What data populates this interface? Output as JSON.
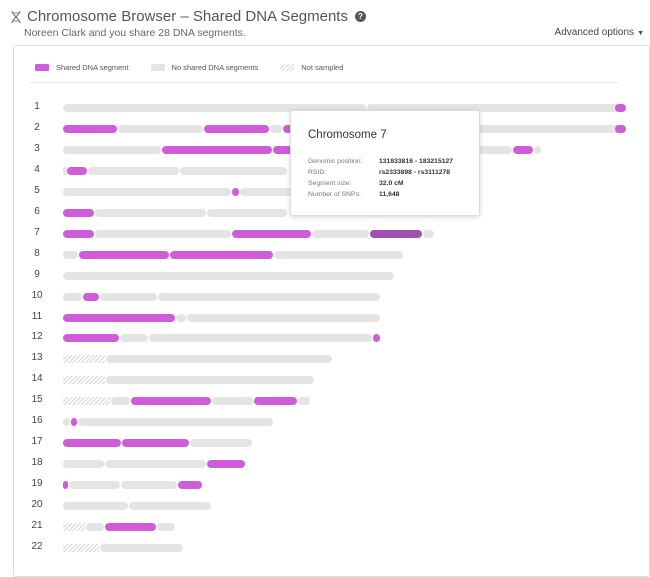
{
  "header": {
    "title": "Chromosome Browser – Shared DNA Segments",
    "subtitle": "Noreen Clark and you share 28 DNA segments.",
    "advanced_label": "Advanced options"
  },
  "legend": {
    "shared": "Shared DNA segment",
    "none": "No shared DNA segments",
    "not_sampled": "Not sampled"
  },
  "colors": {
    "shared": "#cf5cd9",
    "selected": "#a14fb0",
    "none": "#e4e4e4"
  },
  "tooltip": {
    "title": "Chromosome 7",
    "rows": [
      {
        "label": "Genomic position:",
        "value": "131833816 - 183215127"
      },
      {
        "label": "RSID:",
        "value": "rs2333898 - rs3111278"
      },
      {
        "label": "Segment size:",
        "value": "32.0 cM"
      },
      {
        "label": "Number of SNPs:",
        "value": "11,648"
      }
    ]
  },
  "chromosomes": [
    {
      "label": "1",
      "segments": [
        [
          "none",
          0,
          0.54
        ],
        [
          "none",
          0.54,
          1.0
        ],
        [
          "shared",
          1.0,
          1.0
        ]
      ]
    },
    {
      "label": "2",
      "segments": [
        [
          "shared",
          0,
          0.0975
        ],
        [
          "none",
          0.0975,
          0.25
        ],
        [
          "shared",
          0.25,
          0.368
        ],
        [
          "none",
          0.368,
          0.39
        ],
        [
          "shared",
          0.39,
          0.41
        ],
        [
          "none",
          0.41,
          1.0
        ],
        [
          "shared",
          1.0,
          1.0
        ]
      ]
    },
    {
      "label": "3",
      "segments": [
        [
          "none",
          0,
          0.175
        ],
        [
          "shared",
          0.175,
          0.373
        ],
        [
          "shared",
          0.373,
          0.435
        ],
        [
          "none",
          0.435,
          0.8
        ],
        [
          "shared",
          0.8,
          0.837
        ],
        [
          "none",
          0.837,
          0.85
        ]
      ]
    },
    {
      "label": "4",
      "segments": [
        [
          "none",
          0,
          0.007
        ],
        [
          "shared",
          0.007,
          0.045
        ],
        [
          "none",
          0.045,
          0.208
        ],
        [
          "none",
          0.208,
          0.4
        ]
      ]
    },
    {
      "label": "5",
      "segments": [
        [
          "none",
          0,
          0.3
        ],
        [
          "shared",
          0.3,
          0.315
        ],
        [
          "none",
          0.315,
          0.42
        ]
      ]
    },
    {
      "label": "6",
      "segments": [
        [
          "shared",
          0,
          0.057
        ],
        [
          "none",
          0.057,
          0.255
        ],
        [
          "none",
          0.255,
          0.4
        ]
      ]
    },
    {
      "label": "7",
      "segments": [
        [
          "shared",
          0,
          0.057
        ],
        [
          "none",
          0.057,
          0.3
        ],
        [
          "shared",
          0.3,
          0.443
        ],
        [
          "none",
          0.443,
          0.545
        ],
        [
          "sel",
          0.545,
          0.64
        ],
        [
          "none",
          0.64,
          0.66
        ]
      ]
    },
    {
      "label": "8",
      "segments": [
        [
          "none",
          0,
          0.028
        ],
        [
          "shared",
          0.028,
          0.19
        ],
        [
          "shared",
          0.19,
          0.375
        ],
        [
          "none",
          0.375,
          0.605
        ]
      ]
    },
    {
      "label": "9",
      "segments": [
        [
          "none",
          0,
          0.59
        ]
      ]
    },
    {
      "label": "10",
      "segments": [
        [
          "none",
          0,
          0.035
        ],
        [
          "shared",
          0.035,
          0.065
        ],
        [
          "none",
          0.065,
          0.168
        ],
        [
          "none",
          0.168,
          0.565
        ]
      ]
    },
    {
      "label": "11",
      "segments": [
        [
          "shared",
          0,
          0.2
        ],
        [
          "none",
          0.2,
          0.22
        ],
        [
          "none",
          0.22,
          0.565
        ]
      ]
    },
    {
      "label": "12",
      "segments": [
        [
          "shared",
          0,
          0.102
        ],
        [
          "none",
          0.102,
          0.152
        ],
        [
          "none",
          0.152,
          0.55
        ],
        [
          "shared",
          0.55,
          0.565
        ]
      ]
    },
    {
      "label": "13",
      "segments": [
        [
          "ns",
          0,
          0.077
        ],
        [
          "none",
          0.077,
          0.48
        ]
      ]
    },
    {
      "label": "14",
      "segments": [
        [
          "ns",
          0,
          0.077
        ],
        [
          "none",
          0.077,
          0.447
        ]
      ]
    },
    {
      "label": "15",
      "segments": [
        [
          "ns",
          0,
          0.085
        ],
        [
          "none",
          0.085,
          0.12
        ],
        [
          "shared",
          0.12,
          0.265
        ],
        [
          "none",
          0.265,
          0.34
        ],
        [
          "shared",
          0.34,
          0.418
        ],
        [
          "none",
          0.418,
          0.44
        ]
      ]
    },
    {
      "label": "16",
      "segments": [
        [
          "none",
          0,
          0.015
        ],
        [
          "shared",
          0.015,
          0.027
        ],
        [
          "none",
          0.027,
          0.375
        ]
      ]
    },
    {
      "label": "17",
      "segments": [
        [
          "shared",
          0,
          0.105
        ],
        [
          "shared",
          0.105,
          0.225
        ],
        [
          "none",
          0.225,
          0.338
        ]
      ]
    },
    {
      "label": "18",
      "segments": [
        [
          "none",
          0,
          0.075
        ],
        [
          "none",
          0.075,
          0.255
        ],
        [
          "shared",
          0.255,
          0.325
        ]
      ]
    },
    {
      "label": "19",
      "segments": [
        [
          "shared",
          0,
          0.01
        ],
        [
          "none",
          0.01,
          0.103
        ],
        [
          "none",
          0.103,
          0.205
        ],
        [
          "shared",
          0.205,
          0.248
        ]
      ]
    },
    {
      "label": "20",
      "segments": [
        [
          "none",
          0,
          0.117
        ],
        [
          "none",
          0.117,
          0.265
        ]
      ]
    },
    {
      "label": "21",
      "segments": [
        [
          "ns",
          0,
          0.04
        ],
        [
          "none",
          0.04,
          0.075
        ],
        [
          "shared",
          0.075,
          0.167
        ],
        [
          "none",
          0.167,
          0.2
        ]
      ]
    },
    {
      "label": "22",
      "segments": [
        [
          "ns",
          0,
          0.065
        ],
        [
          "none",
          0.065,
          0.215
        ]
      ]
    }
  ]
}
